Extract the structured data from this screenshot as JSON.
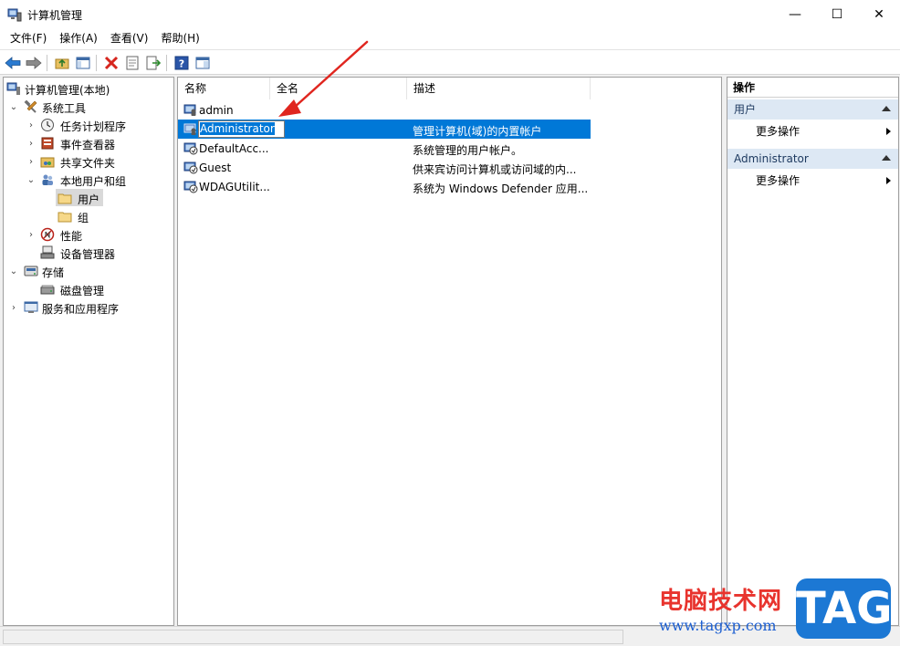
{
  "window": {
    "title": "计算机管理",
    "controls": {
      "minimize": "—",
      "maximize": "☐",
      "close": "✕"
    }
  },
  "menu": [
    "文件(F)",
    "操作(A)",
    "查看(V)",
    "帮助(H)"
  ],
  "toolbar": [
    "back-icon",
    "forward-icon",
    "up-folder-icon",
    "show-hide-tree-icon",
    "delete-icon",
    "properties-icon",
    "export-icon",
    "help-icon",
    "show-hide-action-icon"
  ],
  "tree": {
    "root": "计算机管理(本地)",
    "system_tools": "系统工具",
    "task_scheduler": "任务计划程序",
    "event_viewer": "事件查看器",
    "shared_folders": "共享文件夹",
    "local_users_groups": "本地用户和组",
    "users": "用户",
    "groups": "组",
    "performance": "性能",
    "device_manager": "设备管理器",
    "storage": "存储",
    "disk_management": "磁盘管理",
    "services_apps": "服务和应用程序"
  },
  "list": {
    "columns": [
      "名称",
      "全名",
      "描述"
    ],
    "rows": [
      {
        "name": "admin",
        "fullname": "",
        "description": ""
      },
      {
        "name": "Administrator",
        "fullname": "",
        "description": "管理计算机(域)的内置帐户"
      },
      {
        "name": "DefaultAcc...",
        "fullname": "",
        "description": "系统管理的用户帐户。"
      },
      {
        "name": "Guest",
        "fullname": "",
        "description": "供来宾访问计算机或访问域的内..."
      },
      {
        "name": "WDAGUtilit...",
        "fullname": "",
        "description": "系统为 Windows Defender 应用..."
      }
    ],
    "selected_index": 1
  },
  "actions": {
    "title": "操作",
    "sections": [
      {
        "label": "用户",
        "items": [
          "更多操作"
        ]
      },
      {
        "label": "Administrator",
        "items": [
          "更多操作"
        ]
      }
    ]
  },
  "watermark": {
    "text": "电脑技术网",
    "url": "www.tagxp.com",
    "badge": "TAG"
  },
  "colors": {
    "selection": "#0078d7",
    "section_bg": "#dde8f4",
    "annotation": "#e0261f"
  }
}
